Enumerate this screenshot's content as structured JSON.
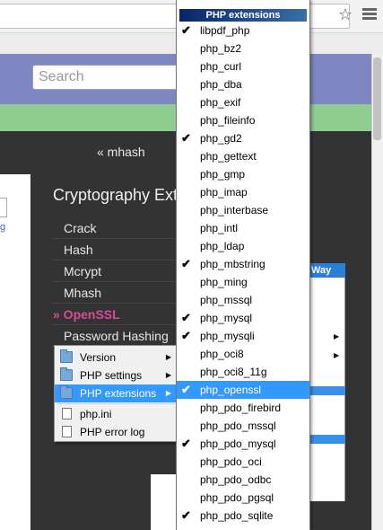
{
  "browser": {
    "star_icon": "star-icon",
    "menu_icon": "hamburger-icon"
  },
  "site": {
    "search_placeholder": "Search",
    "prev_link": "« mhash",
    "section_title": "Cryptography Ext",
    "nav": [
      {
        "label": "Crack",
        "active": false
      },
      {
        "label": "Hash",
        "active": false
      },
      {
        "label": "Mcrypt",
        "active": false
      },
      {
        "label": "Mhash",
        "active": false
      },
      {
        "label": "» OpenSSL",
        "active": true
      },
      {
        "label": "Password Hashing",
        "active": false
      }
    ],
    "left_link": "g",
    "right_way": "Way",
    "right_es": "es"
  },
  "context_menu": {
    "items": [
      {
        "label": "Version",
        "icon": "folder-icon",
        "submenu": true
      },
      {
        "label": "PHP settings",
        "icon": "folder-icon",
        "submenu": true
      },
      {
        "label": "PHP extensions",
        "icon": "folder-icon",
        "submenu": true,
        "highlighted": true
      },
      {
        "label": "php.ini",
        "icon": "file-icon",
        "submenu": false
      },
      {
        "label": "PHP error log",
        "icon": "file-icon",
        "submenu": false
      }
    ]
  },
  "extensions_menu": {
    "header": "PHP extensions",
    "check_glyph": "✔",
    "items": [
      {
        "label": "libpdf_php",
        "checked": true
      },
      {
        "label": "php_bz2",
        "checked": false
      },
      {
        "label": "php_curl",
        "checked": false
      },
      {
        "label": "php_dba",
        "checked": false
      },
      {
        "label": "php_exif",
        "checked": false
      },
      {
        "label": "php_fileinfo",
        "checked": false
      },
      {
        "label": "php_gd2",
        "checked": true
      },
      {
        "label": "php_gettext",
        "checked": false
      },
      {
        "label": "php_gmp",
        "checked": false
      },
      {
        "label": "php_imap",
        "checked": false
      },
      {
        "label": "php_interbase",
        "checked": false
      },
      {
        "label": "php_intl",
        "checked": false
      },
      {
        "label": "php_ldap",
        "checked": false
      },
      {
        "label": "php_mbstring",
        "checked": true
      },
      {
        "label": "php_ming",
        "checked": false
      },
      {
        "label": "php_mssql",
        "checked": false
      },
      {
        "label": "php_mysql",
        "checked": true
      },
      {
        "label": "php_mysqli",
        "checked": true
      },
      {
        "label": "php_oci8",
        "checked": false
      },
      {
        "label": "php_oci8_11g",
        "checked": false
      },
      {
        "label": "php_openssl",
        "checked": true,
        "highlighted": true
      },
      {
        "label": "php_pdo_firebird",
        "checked": false
      },
      {
        "label": "php_pdo_mssql",
        "checked": false
      },
      {
        "label": "php_pdo_mysql",
        "checked": true
      },
      {
        "label": "php_pdo_oci",
        "checked": false
      },
      {
        "label": "php_pdo_odbc",
        "checked": false
      },
      {
        "label": "php_pdo_pgsql",
        "checked": false
      },
      {
        "label": "php_pdo_sqlite",
        "checked": true
      }
    ]
  },
  "colors": {
    "header": "#7e87c2",
    "green_bar": "#8fcc90",
    "page_dark": "#333333",
    "active_nav": "#d94b98",
    "highlight": "#3399ff"
  }
}
